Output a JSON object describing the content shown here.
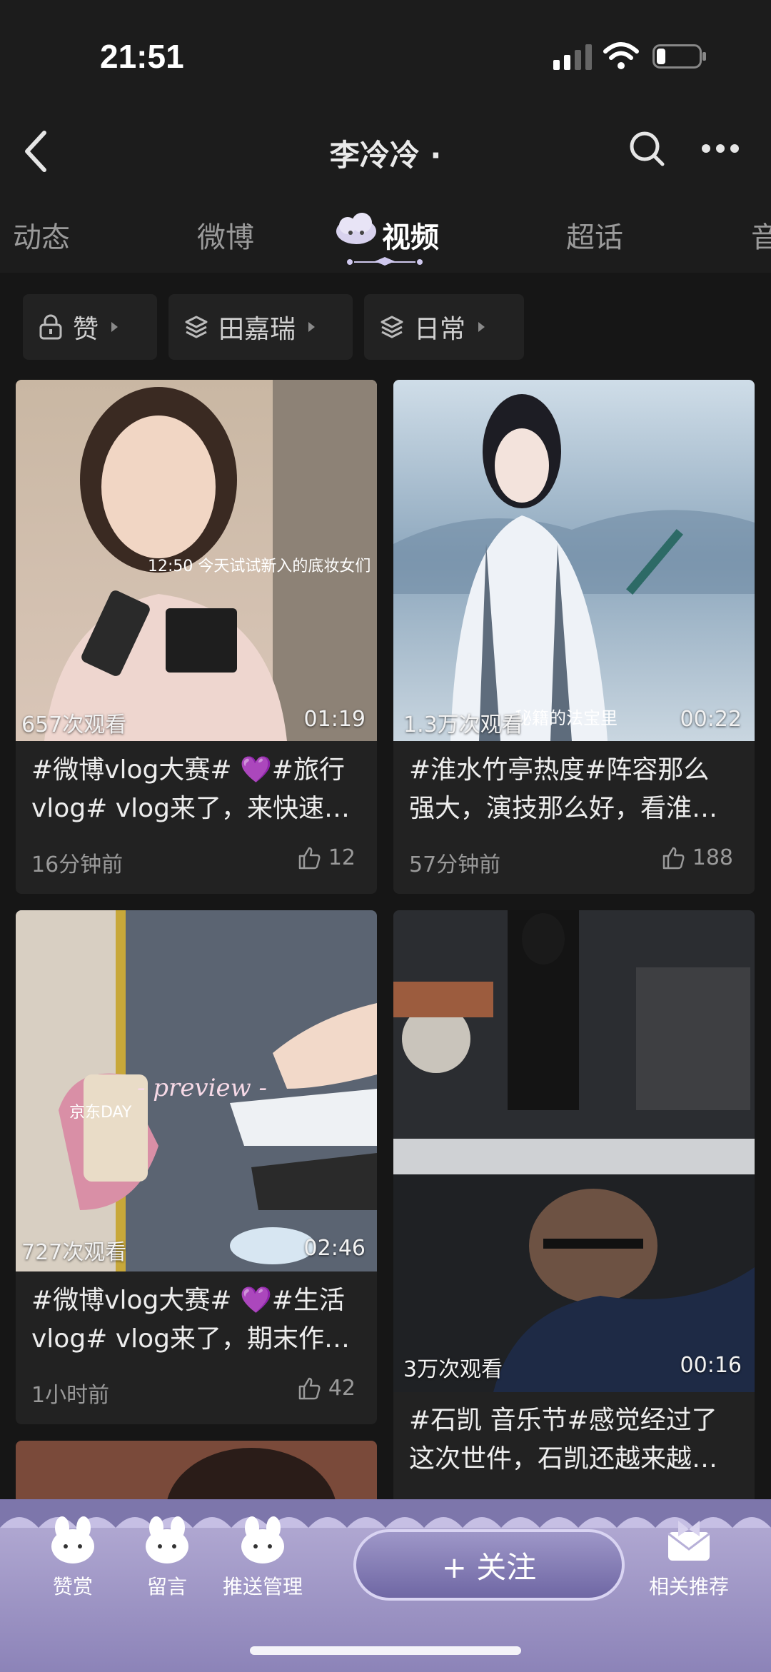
{
  "status": {
    "time": "21:51"
  },
  "nav": {
    "title": "李冷冷 ·"
  },
  "tabs": [
    "动态",
    "微博",
    "视频",
    "超话",
    "音"
  ],
  "filters": [
    "赞",
    "田嘉瑞",
    "日常"
  ],
  "videos": [
    {
      "views": "657次观看",
      "duration": "01:19",
      "overlay_text": "12:50 今天试试新入的底妆女们",
      "title_line1": "#微博vlog大赛# 💜#旅行",
      "title_line2": "vlog# vlog来了，来快速…",
      "time": "16分钟前",
      "likes": "12"
    },
    {
      "views": "1.3万次观看",
      "duration": "00:22",
      "overlay_text": "秘籍的法宝里",
      "title_line1": "#淮水竹亭热度#阵容那么",
      "title_line2": "强大，演技那么好，看淮…",
      "time": "57分钟前",
      "likes": "188"
    },
    {
      "views": "727次观看",
      "duration": "02:46",
      "overlay_text": "- preview -",
      "overlay_text2": "京东DAY",
      "title_line1": "#微博vlog大赛# 💜#生活",
      "title_line2": "vlog# vlog来了，期末作…",
      "time": "1小时前",
      "likes": "42"
    },
    {
      "views": "3万次观看",
      "duration": "00:16",
      "title_line1": "#石凯 音乐节#感觉经过了",
      "title_line2": "这次世件，石凯还越来越…"
    }
  ],
  "bottom": {
    "items": [
      "赞赏",
      "留言",
      "推送管理"
    ],
    "follow": "+ 关注",
    "related": "相关推荐"
  },
  "colors": {
    "background": "#161616",
    "card": "#222222",
    "bottom_bar": "#a89fd0"
  }
}
